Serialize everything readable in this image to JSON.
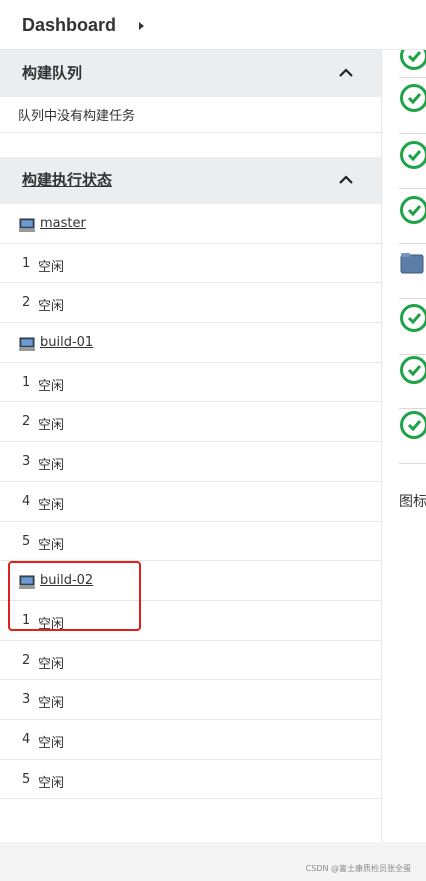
{
  "breadcrumb": {
    "root": "Dashboard"
  },
  "build_queue": {
    "title": "构建队列",
    "empty_text": "队列中没有构建任务"
  },
  "executor_status": {
    "title": "构建执行状态",
    "nodes": [
      {
        "name": "master",
        "executors": [
          {
            "num": "1",
            "state": "空闲"
          },
          {
            "num": "2",
            "state": "空闲"
          }
        ]
      },
      {
        "name": "build-01",
        "executors": [
          {
            "num": "1",
            "state": "空闲"
          },
          {
            "num": "2",
            "state": "空闲"
          },
          {
            "num": "3",
            "state": "空闲"
          },
          {
            "num": "4",
            "state": "空闲"
          },
          {
            "num": "5",
            "state": "空闲"
          }
        ]
      },
      {
        "name": "build-02",
        "executors": [
          {
            "num": "1",
            "state": "空闲"
          },
          {
            "num": "2",
            "state": "空闲"
          },
          {
            "num": "3",
            "state": "空闲"
          },
          {
            "num": "4",
            "state": "空闲"
          },
          {
            "num": "5",
            "state": "空闲"
          }
        ]
      }
    ]
  },
  "right_panel": {
    "status_icons": [
      "success-icon",
      "success-icon",
      "success-icon",
      "success-icon",
      "folder-icon",
      "success-icon",
      "success-icon",
      "success-icon"
    ],
    "legend_text": "图标"
  },
  "footer": {
    "watermark": "CSDN @富士康质检员张全蛋"
  },
  "colors": {
    "success": "#1ea446",
    "section_bg": "#eaeef1",
    "highlight": "#e0201c"
  }
}
